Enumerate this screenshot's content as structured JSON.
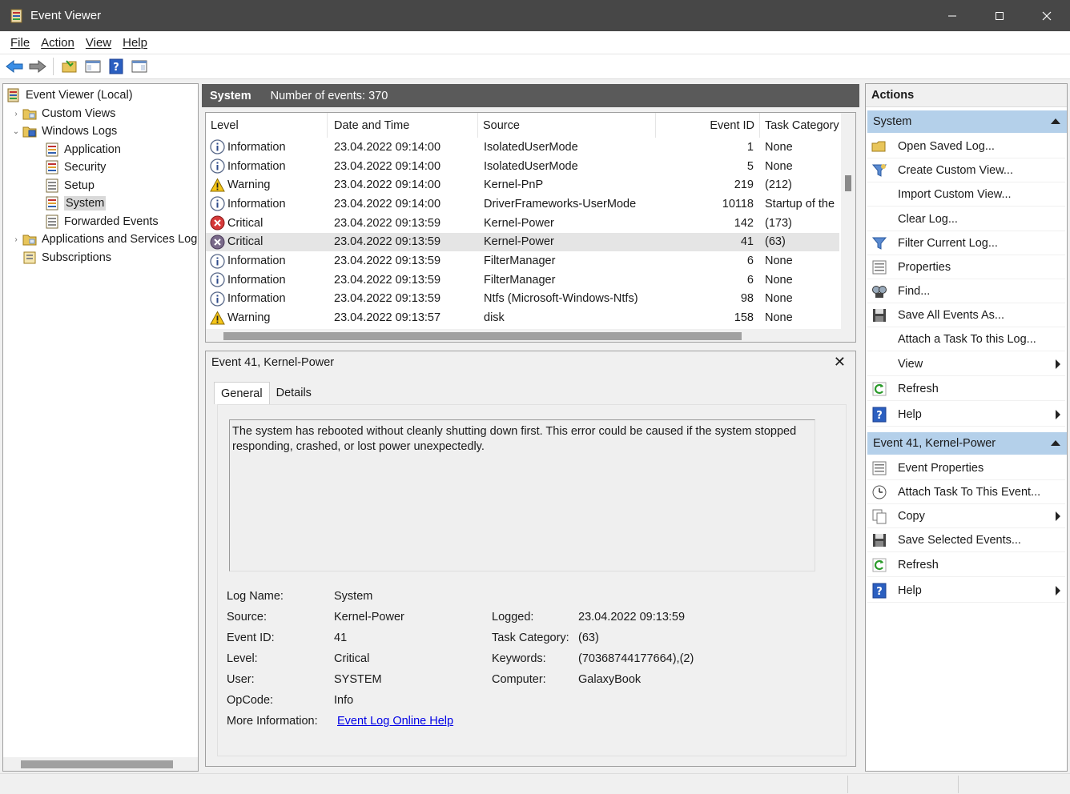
{
  "window": {
    "title": "Event Viewer"
  },
  "menu": [
    "File",
    "Action",
    "View",
    "Help"
  ],
  "tree": {
    "root": "Event Viewer (Local)",
    "custom_views": "Custom Views",
    "windows_logs": "Windows Logs",
    "application": "Application",
    "security": "Security",
    "setup": "Setup",
    "system": "System",
    "forwarded": "Forwarded Events",
    "apps_services": "Applications and Services Log",
    "subscriptions": "Subscriptions"
  },
  "log_header": {
    "name": "System",
    "count": "Number of events: 370"
  },
  "columns": {
    "level": "Level",
    "date": "Date and Time",
    "source": "Source",
    "event_id": "Event ID",
    "task": "Task Category"
  },
  "events": [
    {
      "icon": "info",
      "level": "Information",
      "date": "23.04.2022 09:14:00",
      "source": "IsolatedUserMode",
      "id": "1",
      "task": "None"
    },
    {
      "icon": "info",
      "level": "Information",
      "date": "23.04.2022 09:14:00",
      "source": "IsolatedUserMode",
      "id": "5",
      "task": "None"
    },
    {
      "icon": "warning",
      "level": "Warning",
      "date": "23.04.2022 09:14:00",
      "source": "Kernel-PnP",
      "id": "219",
      "task": "(212)"
    },
    {
      "icon": "info",
      "level": "Information",
      "date": "23.04.2022 09:14:00",
      "source": "DriverFrameworks-UserMode",
      "id": "10118",
      "task": "Startup of the"
    },
    {
      "icon": "critical",
      "level": "Critical",
      "date": "23.04.2022 09:13:59",
      "source": "Kernel-Power",
      "id": "142",
      "task": "(173)"
    },
    {
      "icon": "critical-sel",
      "level": "Critical",
      "date": "23.04.2022 09:13:59",
      "source": "Kernel-Power",
      "id": "41",
      "task": "(63)"
    },
    {
      "icon": "info",
      "level": "Information",
      "date": "23.04.2022 09:13:59",
      "source": "FilterManager",
      "id": "6",
      "task": "None"
    },
    {
      "icon": "info",
      "level": "Information",
      "date": "23.04.2022 09:13:59",
      "source": "FilterManager",
      "id": "6",
      "task": "None"
    },
    {
      "icon": "info",
      "level": "Information",
      "date": "23.04.2022 09:13:59",
      "source": "Ntfs (Microsoft-Windows-Ntfs)",
      "id": "98",
      "task": "None"
    },
    {
      "icon": "warning",
      "level": "Warning",
      "date": "23.04.2022 09:13:57",
      "source": "disk",
      "id": "158",
      "task": "None"
    }
  ],
  "detail": {
    "title": "Event 41, Kernel-Power",
    "tab_general": "General",
    "tab_details": "Details",
    "message": "The system has rebooted without cleanly shutting down first. This error could be caused if the system stopped responding, crashed, or lost power unexpectedly.",
    "labels": {
      "log_name": "Log Name:",
      "source": "Source:",
      "event_id": "Event ID:",
      "level": "Level:",
      "user": "User:",
      "opcode": "OpCode:",
      "more_info": "More Information:",
      "logged": "Logged:",
      "task_category": "Task Category:",
      "keywords": "Keywords:",
      "computer": "Computer:"
    },
    "values": {
      "log_name": "System",
      "source": "Kernel-Power",
      "event_id": "41",
      "level": "Critical",
      "user": "SYSTEM",
      "opcode": "Info",
      "more_info_link": "Event Log Online Help",
      "logged": "23.04.2022 09:13:59",
      "task_category": "(63)",
      "keywords": "(70368744177664),(2)",
      "computer": "GalaxyBook"
    }
  },
  "actions": {
    "title": "Actions",
    "section1": "System",
    "items1": [
      "Open Saved Log...",
      "Create Custom View...",
      "Import Custom View...",
      "Clear Log...",
      "Filter Current Log...",
      "Properties",
      "Find...",
      "Save All Events As...",
      "Attach a Task To this Log...",
      "View",
      "Refresh",
      "Help"
    ],
    "section2": "Event 41, Kernel-Power",
    "items2": [
      "Event Properties",
      "Attach Task To This Event...",
      "Copy",
      "Save Selected Events...",
      "Refresh",
      "Help"
    ]
  },
  "colors": {
    "accent_section": "#b4d0ea",
    "titlebar": "#474747",
    "link": "#0000e6"
  }
}
